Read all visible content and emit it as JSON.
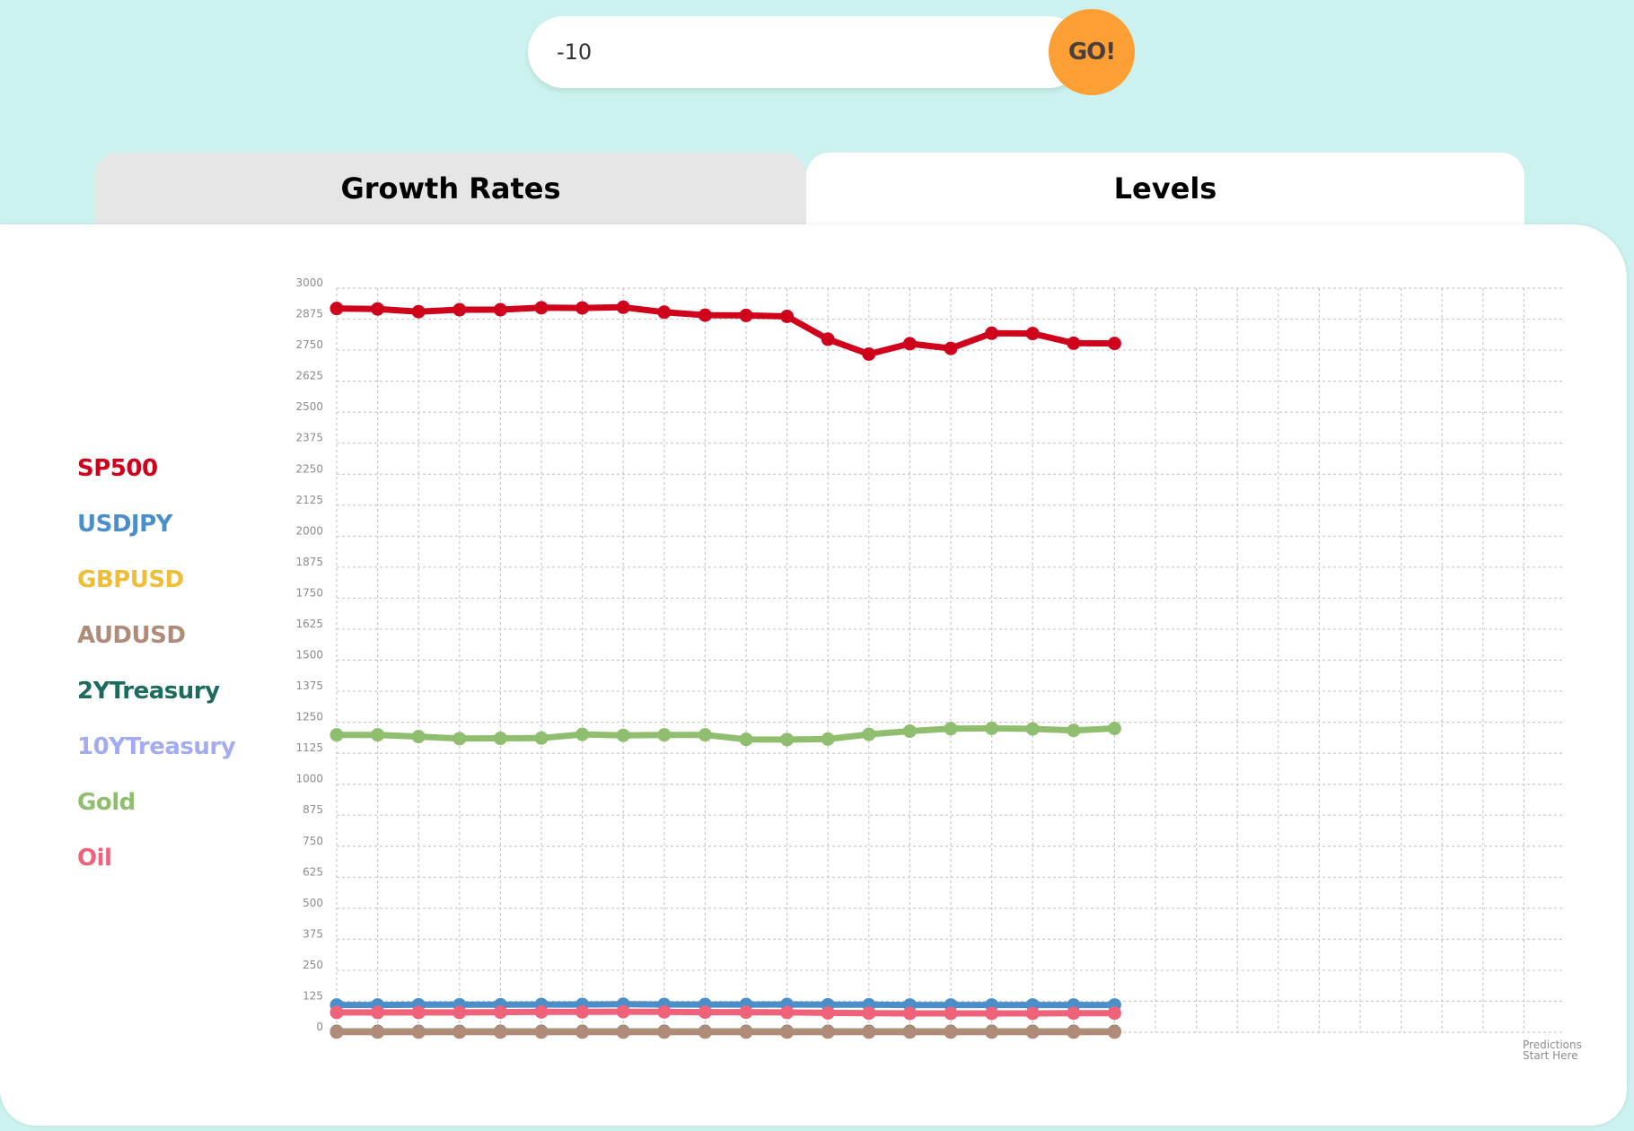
{
  "search": {
    "value": "-10",
    "go_label": "GO!"
  },
  "tabs": {
    "growth": "Growth Rates",
    "levels": "Levels",
    "active": "levels"
  },
  "legend": [
    {
      "label": "SP500",
      "color": "#d0021b"
    },
    {
      "label": "USDJPY",
      "color": "#4a8fc9"
    },
    {
      "label": "GBPUSD",
      "color": "#f0bd36"
    },
    {
      "label": "AUDUSD",
      "color": "#b18b7a"
    },
    {
      "label": "2YTreasury",
      "color": "#1c6b5d"
    },
    {
      "label": "10YTreasury",
      "color": "#a3abf3"
    },
    {
      "label": "Gold",
      "color": "#8fbe6e"
    },
    {
      "label": "Oil",
      "color": "#f0627a"
    }
  ],
  "prediction_note": [
    "Predictions",
    "Start Here"
  ],
  "chart_data": {
    "type": "line",
    "y_ticks": [
      "3000",
      "2875",
      "2750",
      "2625",
      "2500",
      "2375",
      "2250",
      "2125",
      "2000",
      "1875",
      "1750",
      "1625",
      "1500",
      "1375",
      "1250",
      "1125",
      "1000",
      "875",
      "750",
      "625",
      "500",
      "375",
      "250",
      "125",
      "0"
    ],
    "ylim": [
      0,
      3000
    ],
    "x_points": 20,
    "x_grid_columns": 31,
    "grid": true,
    "series": [
      {
        "name": "SP500",
        "color": "#d0021b",
        "values": [
          2918,
          2916,
          2905,
          2913,
          2913,
          2921,
          2920,
          2923,
          2903,
          2891,
          2890,
          2886,
          2794,
          2734,
          2776,
          2757,
          2818,
          2817,
          2778,
          2777
        ]
      },
      {
        "name": "Gold",
        "color": "#8fbe6e",
        "values": [
          1199,
          1199,
          1192,
          1184,
          1185,
          1186,
          1201,
          1197,
          1199,
          1199,
          1181,
          1180,
          1182,
          1201,
          1214,
          1224,
          1225,
          1223,
          1217,
          1225
        ]
      },
      {
        "name": "USDJPY",
        "color": "#4a8fc9",
        "values": [
          110,
          110,
          111,
          111,
          111,
          112,
          112,
          113,
          112,
          112,
          112,
          112,
          111,
          111,
          110,
          110,
          110,
          110,
          110,
          110
        ]
      },
      {
        "name": "Oil",
        "color": "#f0627a",
        "values": [
          80,
          80,
          80,
          80,
          81,
          82,
          82,
          83,
          82,
          81,
          81,
          80,
          78,
          77,
          76,
          76,
          76,
          76,
          77,
          77
        ]
      },
      {
        "name": "10YTreasury",
        "color": "#a3abf3",
        "values": [
          3,
          3,
          3,
          3,
          3,
          3,
          3,
          3,
          3,
          3,
          3,
          3,
          3,
          3,
          3,
          3,
          3,
          3,
          3,
          3
        ]
      },
      {
        "name": "2YTreasury",
        "color": "#1c6b5d",
        "values": [
          3,
          3,
          3,
          3,
          3,
          3,
          3,
          3,
          3,
          3,
          3,
          3,
          3,
          3,
          3,
          3,
          3,
          3,
          3,
          3
        ]
      },
      {
        "name": "GBPUSD",
        "color": "#f0bd36",
        "values": [
          1.3,
          1.3,
          1.3,
          1.3,
          1.3,
          1.3,
          1.3,
          1.3,
          1.3,
          1.3,
          1.3,
          1.3,
          1.3,
          1.3,
          1.3,
          1.3,
          1.3,
          1.3,
          1.3,
          1.3
        ]
      },
      {
        "name": "AUDUSD",
        "color": "#b18b7a",
        "values": [
          0.7,
          0.7,
          0.7,
          0.7,
          0.7,
          0.7,
          0.7,
          0.7,
          0.7,
          0.7,
          0.7,
          0.7,
          0.7,
          0.7,
          0.7,
          0.7,
          0.7,
          0.7,
          0.7,
          0.7
        ]
      }
    ]
  }
}
